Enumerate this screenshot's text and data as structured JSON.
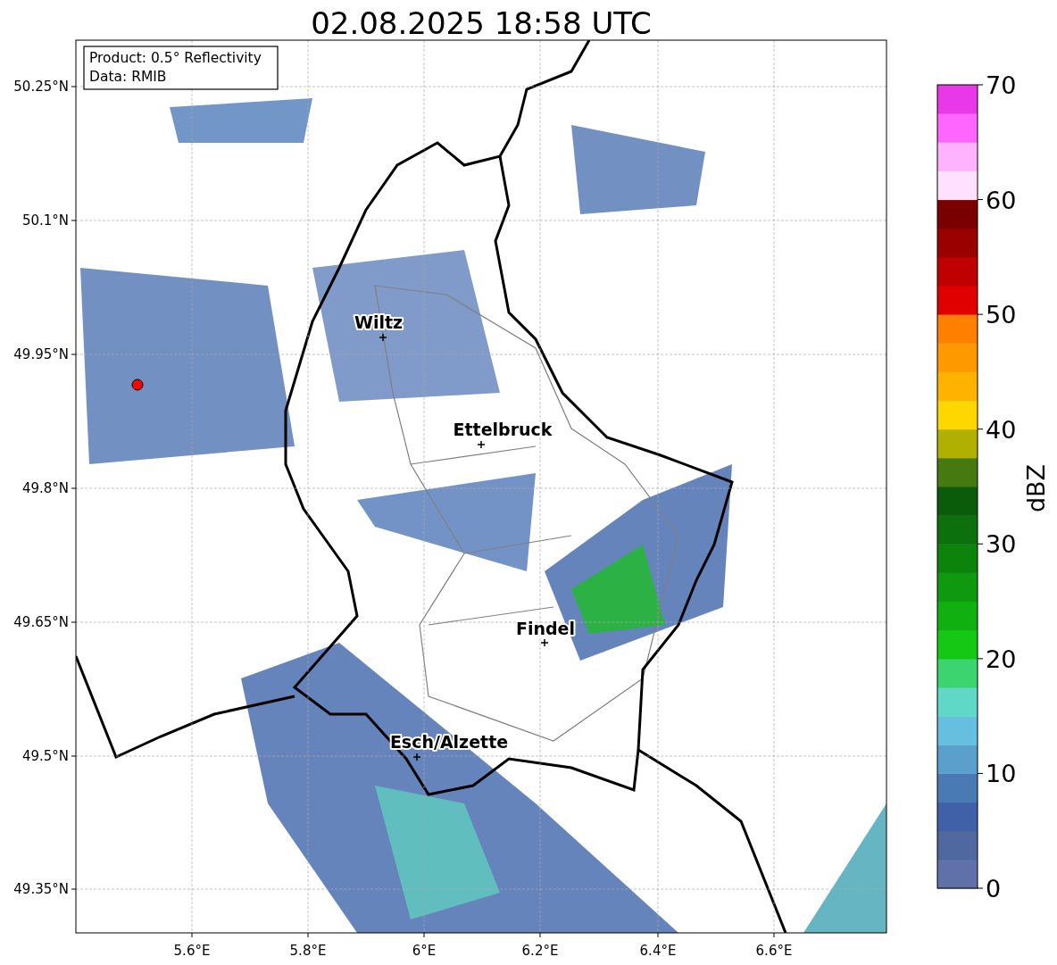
{
  "title": "02.08.2025 18:58 UTC",
  "info_box": [
    "Product: 0.5° Reflectivity",
    "Data: RMIB"
  ],
  "x_ticks": [
    "5.6°E",
    "5.8°E",
    "6°E",
    "6.2°E",
    "6.4°E",
    "6.6°E"
  ],
  "y_ticks": [
    "50.25°N",
    "50.1°N",
    "49.95°N",
    "49.8°N",
    "49.65°N",
    "49.5°N",
    "49.35°N"
  ],
  "cities": [
    {
      "name": "Wiltz"
    },
    {
      "name": "Ettelbruck"
    },
    {
      "name": "Findel"
    },
    {
      "name": "Esch/Alzette"
    }
  ],
  "colorbar": {
    "label": "dBZ",
    "ticks": [
      "70",
      "60",
      "50",
      "40",
      "30",
      "20",
      "10",
      "0"
    ],
    "segments": [
      {
        "color": "#6070a8"
      },
      {
        "color": "#5068a0"
      },
      {
        "color": "#4060a8"
      },
      {
        "color": "#4a7ab4"
      },
      {
        "color": "#5aa0cc"
      },
      {
        "color": "#66bfdf"
      },
      {
        "color": "#60d8c8"
      },
      {
        "color": "#3cd46e"
      },
      {
        "color": "#14c814"
      },
      {
        "color": "#10b010"
      },
      {
        "color": "#0e990e"
      },
      {
        "color": "#0c840c"
      },
      {
        "color": "#0c700c"
      },
      {
        "color": "#0a5c0a"
      },
      {
        "color": "#467a10"
      },
      {
        "color": "#b0b000"
      },
      {
        "color": "#ffd700"
      },
      {
        "color": "#ffb300"
      },
      {
        "color": "#ff9900"
      },
      {
        "color": "#ff7f00"
      },
      {
        "color": "#e00000"
      },
      {
        "color": "#c00000"
      },
      {
        "color": "#9a0000"
      },
      {
        "color": "#7a0000"
      },
      {
        "color": "#ffe0ff"
      },
      {
        "color": "#ffb3ff"
      },
      {
        "color": "#ff66ff"
      },
      {
        "color": "#e838e8"
      }
    ]
  }
}
